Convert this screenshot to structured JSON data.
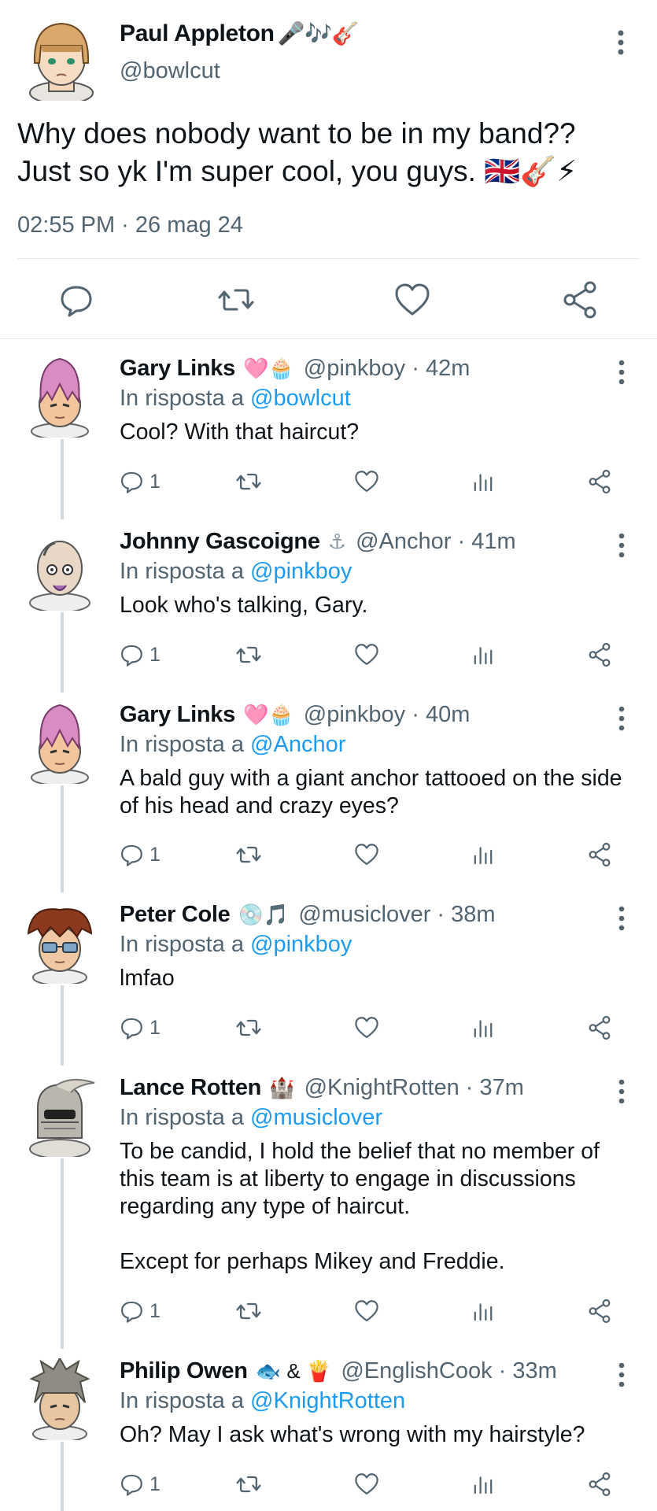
{
  "main_tweet": {
    "name": "Paul Appleton",
    "name_emojis": "🎤🎶🎸",
    "handle": "@bowlcut",
    "text_line1": "Why does nobody want to be in my band??",
    "text_line2": "Just so yk I'm super cool, you guys. 🇬🇧🎸⚡",
    "timestamp": "02:55 PM · 26 mag 24",
    "actions": [
      "reply-icon",
      "retweet-icon",
      "like-icon",
      "share-icon"
    ]
  },
  "replies": [
    {
      "name": "Gary Links",
      "emojis": "🩷🧁",
      "handle": "@pinkboy",
      "time": "42m",
      "reply_prefix": "In risposta a ",
      "reply_to": "@bowlcut",
      "text": "Cool? With that haircut?",
      "reply_count": "1",
      "avatar": "pink-hair-avatar"
    },
    {
      "name": "Johnny Gascoigne",
      "emojis": "⚓",
      "handle": "@Anchor",
      "time": "41m",
      "reply_prefix": "In risposta a ",
      "reply_to": "@pinkboy",
      "text": "Look who's talking, Gary.",
      "reply_count": "1",
      "avatar": "bald-anchor-avatar"
    },
    {
      "name": "Gary Links",
      "emojis": "🩷🧁",
      "handle": "@pinkboy",
      "time": "40m",
      "reply_prefix": "In risposta a ",
      "reply_to": "@Anchor",
      "text": "A bald guy with a giant anchor tattooed on the side of his head and crazy eyes?",
      "reply_count": "1",
      "avatar": "pink-hair-avatar"
    },
    {
      "name": "Peter Cole",
      "emojis": "💿🎵",
      "handle": "@musiclover",
      "time": "38m",
      "reply_prefix": "In risposta a ",
      "reply_to": "@pinkboy",
      "text": "lmfao",
      "reply_count": "1",
      "avatar": "sunglasses-avatar"
    },
    {
      "name": "Lance Rotten",
      "emojis": "🏰",
      "handle": "@KnightRotten",
      "time": "37m",
      "reply_prefix": "In risposta a ",
      "reply_to": "@musiclover",
      "text": "To be candid, I hold the belief that no member of this team is at liberty to engage in discussions regarding any type of haircut.\n\nExcept for perhaps Mikey and Freddie.",
      "reply_count": "1",
      "avatar": "knight-helmet-avatar"
    },
    {
      "name": "Philip Owen",
      "emojis": "🐟 & 🍟",
      "handle": "@EnglishCook",
      "time": "33m",
      "reply_prefix": "In risposta a ",
      "reply_to": "@KnightRotten",
      "text": "Oh? May I ask what's wrong with my hairstyle?",
      "reply_count": "1",
      "avatar": "grey-spiky-avatar"
    }
  ],
  "separator": "·",
  "colors": {
    "text": "#0f1419",
    "secondary": "#536471",
    "link": "#1d9bf0",
    "divider": "#e6e9ec",
    "thread_line": "#cfd9de"
  }
}
